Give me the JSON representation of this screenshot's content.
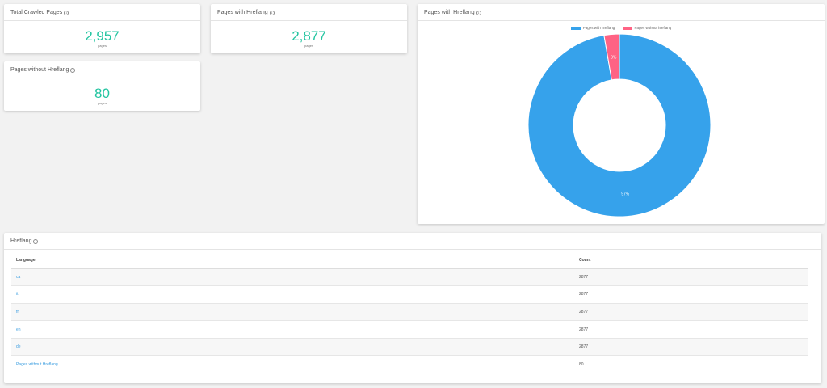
{
  "cards": {
    "total": {
      "title": "Total Crawled Pages",
      "value": "2,957",
      "unit": "pages"
    },
    "with_hreflang": {
      "title": "Pages with Hreflang",
      "value": "2,877",
      "unit": "pages"
    },
    "without_hreflang": {
      "title": "Pages without Hreflang",
      "value": "80",
      "unit": "pages"
    }
  },
  "info_glyph": "i",
  "chart_card": {
    "title": "Pages with Hreflang",
    "chart_data": {
      "type": "pie",
      "categories": [
        "Pages with hreflang",
        "Pages without hreflang"
      ],
      "values": [
        2877,
        80
      ],
      "labels": [
        "97%",
        "3%"
      ],
      "colors": [
        "#36a2eb",
        "#ff6384"
      ],
      "legend": "top"
    }
  },
  "table_card": {
    "title": "Hreflang",
    "columns": [
      "Language",
      "Count"
    ],
    "rows": [
      {
        "language": "ca",
        "count": "2877"
      },
      {
        "language": "it",
        "count": "2877"
      },
      {
        "language": "fr",
        "count": "2877"
      },
      {
        "language": "en",
        "count": "2877"
      },
      {
        "language": "de",
        "count": "2877"
      },
      {
        "language": "Pages without Hreflang",
        "count": "80"
      }
    ]
  }
}
